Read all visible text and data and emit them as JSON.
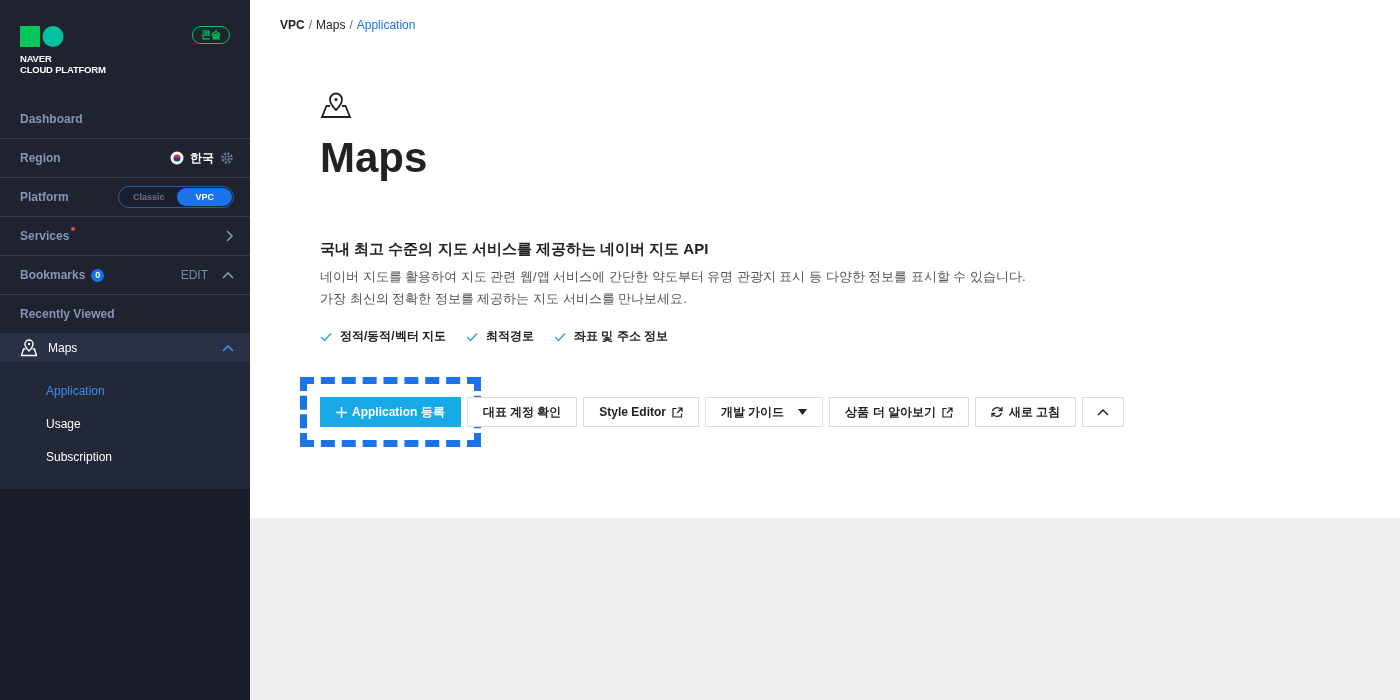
{
  "sidebar": {
    "logo": {
      "lines": [
        "NAVER",
        "CLOUD PLATFORM"
      ]
    },
    "console_badge": "콘솔",
    "items": [
      {
        "kind": "link",
        "label": "Dashboard"
      },
      {
        "kind": "region",
        "label": "Region",
        "value": "한국"
      },
      {
        "kind": "toggle",
        "label": "Platform",
        "options": [
          {
            "label": "Classic",
            "selected": false
          },
          {
            "label": "VPC",
            "selected": true
          }
        ]
      },
      {
        "kind": "nav",
        "label": "Services",
        "new": true
      },
      {
        "kind": "bookmarks",
        "label": "Bookmarks",
        "count": "0",
        "action": "EDIT",
        "expanded": true
      },
      {
        "kind": "link",
        "label": "Recently Viewed"
      },
      {
        "kind": "section",
        "label": "Maps",
        "expanded": true,
        "children": [
          {
            "label": "Application",
            "selected": true
          },
          {
            "label": "Usage",
            "selected": false
          },
          {
            "label": "Subscription",
            "selected": false
          }
        ]
      }
    ]
  },
  "breadcrumb": [
    {
      "label": "VPC",
      "current": false
    },
    {
      "separator": "/",
      "label": "Maps",
      "current": false
    },
    {
      "separator": "/",
      "label": "Application",
      "current": true
    }
  ],
  "page": {
    "title": "Maps",
    "subtitle": "국내 최고 수준의 지도 서비스를 제공하는 네이버 지도 API",
    "description": [
      "네이버 지도를 활용하여 지도 관련 웹/앱 서비스에 간단한 약도부터 유명 관광지 표시 등 다양한 정보를 표시할 수 있습니다.",
      "가장 최신의 정확한 정보를 제공하는 지도 서비스를 만나보세요."
    ],
    "features": [
      "정적/동적/벡터 지도",
      "최적경로",
      "좌표 및 주소 정보"
    ],
    "buttons": [
      {
        "kind": "primary",
        "label": "Application 등록",
        "highlighted": true
      },
      {
        "kind": "plain",
        "label": "대표 계정 확인",
        "highlighted": false
      },
      {
        "kind": "external",
        "label": "Style Editor",
        "highlighted": false
      },
      {
        "kind": "dropdown",
        "label": "개발 가이드",
        "highlighted": false
      },
      {
        "kind": "external",
        "label": "상품 더 알아보기",
        "highlighted": false
      },
      {
        "kind": "refresh",
        "label": "새로 고침",
        "highlighted": false
      },
      {
        "kind": "collapse",
        "highlighted": false
      }
    ]
  }
}
